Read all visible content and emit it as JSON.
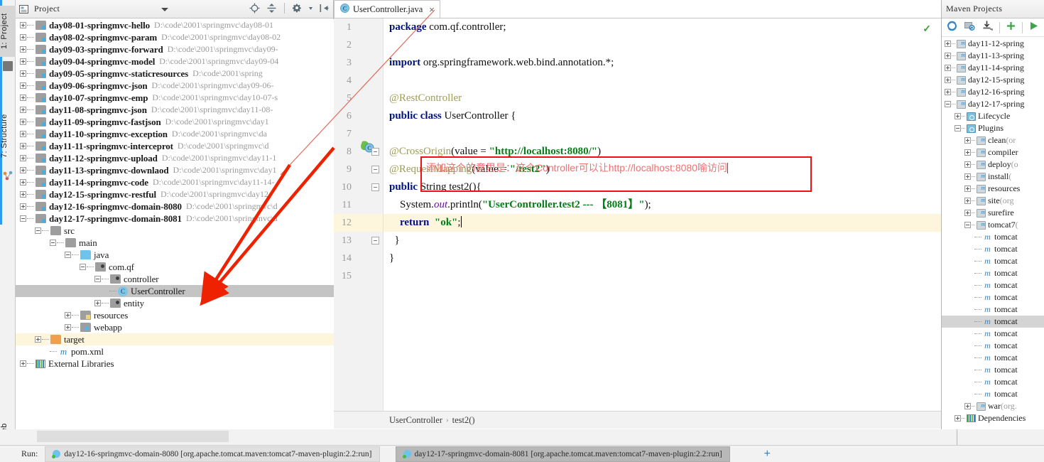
{
  "left_strip": {
    "tabs": [
      {
        "label": "1: Project",
        "selected": true
      },
      {
        "label": "7: Structure",
        "selected": false
      },
      {
        "label": "Web",
        "selected": false
      }
    ]
  },
  "project_panel": {
    "title": "Project",
    "scope_label": "Project",
    "toolbar": [
      {
        "name": "locate-icon",
        "label": "Select Opened File"
      },
      {
        "name": "collapse-all-icon",
        "label": "Collapse All"
      },
      {
        "name": "settings-gear-icon",
        "label": "Settings"
      },
      {
        "name": "hide-panel-icon",
        "label": "Hide"
      }
    ],
    "tree": [
      {
        "label": "day08-01-springmvc-hello",
        "path": "D:\\code\\2001\\springmvc\\day08-01",
        "indent": 0,
        "icon": "module-folder",
        "state": "collapsed",
        "bold": true
      },
      {
        "label": "day08-02-springmvc-param",
        "path": "D:\\code\\2001\\springmvc\\day08-02",
        "indent": 0,
        "icon": "module-folder",
        "state": "collapsed",
        "bold": true
      },
      {
        "label": "day09-03-springmvc-forward",
        "path": "D:\\code\\2001\\springmvc\\day09-",
        "indent": 0,
        "icon": "module-folder",
        "state": "collapsed",
        "bold": true
      },
      {
        "label": "day09-04-springmvc-model",
        "path": "D:\\code\\2001\\springmvc\\day09-04",
        "indent": 0,
        "icon": "module-folder",
        "state": "collapsed",
        "bold": true
      },
      {
        "label": "day09-05-springmvc-staticresources",
        "path": "D:\\code\\2001\\spring",
        "indent": 0,
        "icon": "module-folder",
        "state": "collapsed",
        "bold": true
      },
      {
        "label": "day09-06-springmvc-json",
        "path": "D:\\code\\2001\\springmvc\\day09-06-",
        "indent": 0,
        "icon": "module-folder",
        "state": "collapsed",
        "bold": true
      },
      {
        "label": "day10-07-springmvc-emp",
        "path": "D:\\code\\2001\\springmvc\\day10-07-s",
        "indent": 0,
        "icon": "module-folder",
        "state": "collapsed",
        "bold": true
      },
      {
        "label": "day11-08-springmvc-json",
        "path": "D:\\code\\2001\\springmvc\\day11-08-",
        "indent": 0,
        "icon": "module-folder",
        "state": "collapsed",
        "bold": true
      },
      {
        "label": "day11-09-springmvc-fastjson",
        "path": "D:\\code\\2001\\springmvc\\day1",
        "indent": 0,
        "icon": "module-folder",
        "state": "collapsed",
        "bold": true
      },
      {
        "label": "day11-10-springmvc-exception",
        "path": "D:\\code\\2001\\springmvc\\da",
        "indent": 0,
        "icon": "module-folder",
        "state": "collapsed",
        "bold": true
      },
      {
        "label": "day11-11-springmvc-interceprot",
        "path": "D:\\code\\2001\\springmvc\\d",
        "indent": 0,
        "icon": "module-folder",
        "state": "collapsed",
        "bold": true
      },
      {
        "label": "day11-12-springmvc-upload",
        "path": "D:\\code\\2001\\springmvc\\day11-1",
        "indent": 0,
        "icon": "module-folder",
        "state": "collapsed",
        "bold": true
      },
      {
        "label": "day11-13-springmvc-downlaod",
        "path": "D:\\code\\2001\\springmvc\\day1",
        "indent": 0,
        "icon": "module-folder",
        "state": "collapsed",
        "bold": true
      },
      {
        "label": "day11-14-springmvc-code",
        "path": "D:\\code\\2001\\springmvc\\day11-14-",
        "indent": 0,
        "icon": "module-folder",
        "state": "collapsed",
        "bold": true
      },
      {
        "label": "day12-15-springmvc-restful",
        "path": "D:\\code\\2001\\springmvc\\day12-",
        "indent": 0,
        "icon": "module-folder",
        "state": "collapsed",
        "bold": true
      },
      {
        "label": "day12-16-springmvc-domain-8080",
        "path": "D:\\code\\2001\\springmvc\\d",
        "indent": 0,
        "icon": "module-folder",
        "state": "collapsed",
        "bold": true
      },
      {
        "label": "day12-17-springmvc-domain-8081",
        "path": "D:\\code\\2001\\springmvc\\d",
        "indent": 0,
        "icon": "module-folder",
        "state": "expanded",
        "bold": true
      },
      {
        "label": "src",
        "path": "",
        "indent": 1,
        "icon": "folder-plain",
        "state": "expanded",
        "bold": false
      },
      {
        "label": "main",
        "path": "",
        "indent": 2,
        "icon": "folder-plain",
        "state": "expanded",
        "bold": false
      },
      {
        "label": "java",
        "path": "",
        "indent": 3,
        "icon": "folder-blue",
        "state": "expanded",
        "bold": false
      },
      {
        "label": "com.qf",
        "path": "",
        "indent": 4,
        "icon": "folder-package",
        "state": "expanded",
        "bold": false
      },
      {
        "label": "controller",
        "path": "",
        "indent": 5,
        "icon": "folder-package",
        "state": "expanded",
        "bold": false
      },
      {
        "label": "UserController",
        "path": "",
        "indent": 6,
        "icon": "class-icon",
        "state": "leaf",
        "bold": false,
        "selected": true
      },
      {
        "label": "entity",
        "path": "",
        "indent": 5,
        "icon": "folder-package",
        "state": "collapsed",
        "bold": false
      },
      {
        "label": "resources",
        "path": "",
        "indent": 3,
        "icon": "folder-resources",
        "state": "collapsed",
        "bold": false
      },
      {
        "label": "webapp",
        "path": "",
        "indent": 3,
        "icon": "folder-webapp",
        "state": "collapsed",
        "bold": false
      },
      {
        "label": "target",
        "path": "",
        "indent": 1,
        "icon": "folder-target",
        "state": "collapsed",
        "bold": false,
        "highlight": true
      },
      {
        "label": "pom.xml",
        "path": "",
        "indent": 2,
        "icon": "maven-file",
        "state": "leaf",
        "bold": false
      },
      {
        "label": "External Libraries",
        "path": "",
        "indent": 0,
        "icon": "libraries",
        "state": "collapsed",
        "bold": false
      }
    ]
  },
  "editor": {
    "tab": {
      "label": "UserController.java",
      "icon": "java-class-icon",
      "close": "×"
    },
    "inspection_status": "✓",
    "lines": [
      {
        "n": "1",
        "tokens": [
          {
            "t": "package",
            "c": "kw"
          },
          {
            "t": " com.qf.controller;",
            "c": "plain"
          }
        ]
      },
      {
        "n": "2",
        "tokens": []
      },
      {
        "n": "3",
        "tokens": [
          {
            "t": "import",
            "c": "kw"
          },
          {
            "t": " org.springframework.web.bind.annotation.*;",
            "c": "plain"
          }
        ]
      },
      {
        "n": "4",
        "tokens": []
      },
      {
        "n": "5",
        "tokens": [
          {
            "t": "@RestController",
            "c": "ann"
          }
        ]
      },
      {
        "n": "6",
        "tokens": [
          {
            "t": "public class ",
            "c": "kw"
          },
          {
            "t": "UserController {",
            "c": "plain"
          }
        ]
      },
      {
        "n": "7",
        "tokens": []
      },
      {
        "n": "8",
        "tokens": [
          {
            "t": "@CrossOrigin",
            "c": "ann"
          },
          {
            "t": "(value = ",
            "c": "plain"
          },
          {
            "t": "\"http://localhost:8080/\"",
            "c": "str"
          },
          {
            "t": ")",
            "c": "plain"
          }
        ]
      },
      {
        "n": "9",
        "tokens": [
          {
            "t": "@RequestMapping",
            "c": "ann"
          },
          {
            "t": "(value = ",
            "c": "plain"
          },
          {
            "t": "\"/test2\"",
            "c": "str"
          },
          {
            "t": ")",
            "c": "plain"
          }
        ]
      },
      {
        "n": "10",
        "tokens": [
          {
            "t": "public ",
            "c": "kw"
          },
          {
            "t": "String test2(){",
            "c": "plain"
          }
        ]
      },
      {
        "n": "11",
        "tokens": [
          {
            "t": "    System.",
            "c": "plain"
          },
          {
            "t": "out",
            "c": "fld"
          },
          {
            "t": ".println(",
            "c": "plain"
          },
          {
            "t": "\"UserController.test2 --- 【8081】\"",
            "c": "str"
          },
          {
            "t": ");",
            "c": "plain"
          }
        ]
      },
      {
        "n": "12",
        "tokens": [
          {
            "t": "    ",
            "c": "plain"
          },
          {
            "t": "return",
            "c": "kw"
          },
          {
            "t": "  ",
            "c": "plain"
          },
          {
            "t": "\"ok\"",
            "c": "str"
          },
          {
            "t": ";",
            "c": "plain"
          }
        ],
        "highlight": true,
        "caret": true
      },
      {
        "n": "13",
        "tokens": [
          {
            "t": "  }",
            "c": "plain"
          }
        ]
      },
      {
        "n": "14",
        "tokens": [
          {
            "t": "}",
            "c": "plain"
          }
        ]
      },
      {
        "n": "15",
        "tokens": []
      }
    ],
    "annotation": {
      "text": "添加这个的意思是：这个Controller可以让http://localhost:8080喻访问",
      "box_color": "#ee1111",
      "text_color": "#f07070"
    },
    "breadcrumb": [
      {
        "label": "UserController"
      },
      {
        "label": "test2()"
      }
    ],
    "breadcrumb_separator": "›"
  },
  "maven_panel": {
    "title": "Maven Projects",
    "toolbar": [
      {
        "name": "reimport-icon",
        "label": "Reimport All Maven Projects"
      },
      {
        "name": "generate-sources-icon",
        "label": "Generate Sources"
      },
      {
        "name": "download-sources-icon",
        "label": "Download Sources"
      },
      {
        "name": "add-maven-project-icon",
        "label": "Add Maven Projects"
      },
      {
        "name": "execute-goal-icon",
        "label": "Run Maven Build"
      }
    ],
    "tree": [
      {
        "label": "day11-12-spring",
        "suffix": "",
        "indent": 0,
        "icon": "maven-project",
        "state": "collapsed"
      },
      {
        "label": "day11-13-spring",
        "suffix": "",
        "indent": 0,
        "icon": "maven-project",
        "state": "collapsed"
      },
      {
        "label": "day11-14-spring",
        "suffix": "",
        "indent": 0,
        "icon": "maven-project",
        "state": "collapsed"
      },
      {
        "label": "day12-15-spring",
        "suffix": "",
        "indent": 0,
        "icon": "maven-project",
        "state": "collapsed"
      },
      {
        "label": "day12-16-spring",
        "suffix": "",
        "indent": 0,
        "icon": "maven-project",
        "state": "collapsed"
      },
      {
        "label": "day12-17-spring",
        "suffix": "",
        "indent": 0,
        "icon": "maven-project",
        "state": "expanded"
      },
      {
        "label": "Lifecycle",
        "suffix": "",
        "indent": 1,
        "icon": "lifecycle",
        "state": "collapsed"
      },
      {
        "label": "Plugins",
        "suffix": "",
        "indent": 1,
        "icon": "plugins",
        "state": "expanded"
      },
      {
        "label": "clean",
        "suffix": "(or",
        "indent": 2,
        "icon": "plugin",
        "state": "collapsed"
      },
      {
        "label": "compiler",
        "suffix": "",
        "indent": 2,
        "icon": "plugin",
        "state": "collapsed"
      },
      {
        "label": "deploy",
        "suffix": "(o",
        "indent": 2,
        "icon": "plugin",
        "state": "collapsed"
      },
      {
        "label": "install",
        "suffix": "(",
        "indent": 2,
        "icon": "plugin",
        "state": "collapsed"
      },
      {
        "label": "resources",
        "suffix": "",
        "indent": 2,
        "icon": "plugin",
        "state": "collapsed"
      },
      {
        "label": "site",
        "suffix": "(org",
        "indent": 2,
        "icon": "plugin",
        "state": "collapsed"
      },
      {
        "label": "surefire",
        "suffix": "",
        "indent": 2,
        "icon": "plugin",
        "state": "collapsed"
      },
      {
        "label": "tomcat7",
        "suffix": "(",
        "indent": 2,
        "icon": "plugin",
        "state": "expanded"
      },
      {
        "label": "tomcat",
        "suffix": "",
        "indent": 3,
        "icon": "goal",
        "state": "leaf"
      },
      {
        "label": "tomcat",
        "suffix": "",
        "indent": 3,
        "icon": "goal",
        "state": "leaf"
      },
      {
        "label": "tomcat",
        "suffix": "",
        "indent": 3,
        "icon": "goal",
        "state": "leaf"
      },
      {
        "label": "tomcat",
        "suffix": "",
        "indent": 3,
        "icon": "goal",
        "state": "leaf"
      },
      {
        "label": "tomcat",
        "suffix": "",
        "indent": 3,
        "icon": "goal",
        "state": "leaf"
      },
      {
        "label": "tomcat",
        "suffix": "",
        "indent": 3,
        "icon": "goal",
        "state": "leaf"
      },
      {
        "label": "tomcat",
        "suffix": "",
        "indent": 3,
        "icon": "goal",
        "state": "leaf"
      },
      {
        "label": "tomcat",
        "suffix": "",
        "indent": 3,
        "icon": "goal",
        "state": "leaf",
        "selected": true
      },
      {
        "label": "tomcat",
        "suffix": "",
        "indent": 3,
        "icon": "goal",
        "state": "leaf"
      },
      {
        "label": "tomcat",
        "suffix": "",
        "indent": 3,
        "icon": "goal",
        "state": "leaf"
      },
      {
        "label": "tomcat",
        "suffix": "",
        "indent": 3,
        "icon": "goal",
        "state": "leaf"
      },
      {
        "label": "tomcat",
        "suffix": "",
        "indent": 3,
        "icon": "goal",
        "state": "leaf"
      },
      {
        "label": "tomcat",
        "suffix": "",
        "indent": 3,
        "icon": "goal",
        "state": "leaf"
      },
      {
        "label": "tomcat",
        "suffix": "",
        "indent": 3,
        "icon": "goal",
        "state": "leaf"
      },
      {
        "label": "war",
        "suffix": "(org.",
        "indent": 2,
        "icon": "plugin",
        "state": "collapsed"
      },
      {
        "label": "Dependencies",
        "suffix": "",
        "indent": 1,
        "icon": "dependencies",
        "state": "collapsed"
      }
    ]
  },
  "run_bar": {
    "label": "Run:",
    "configs": [
      {
        "label": "day12-16-springmvc-domain-8080 [org.apache.tomcat.maven:tomcat7-maven-plugin:2.2:run]",
        "active": false
      },
      {
        "label": "day12-17-springmvc-domain-8081 [org.apache.tomcat.maven:tomcat7-maven-plugin:2.2:run]",
        "active": true
      }
    ],
    "add_tab": "+"
  }
}
